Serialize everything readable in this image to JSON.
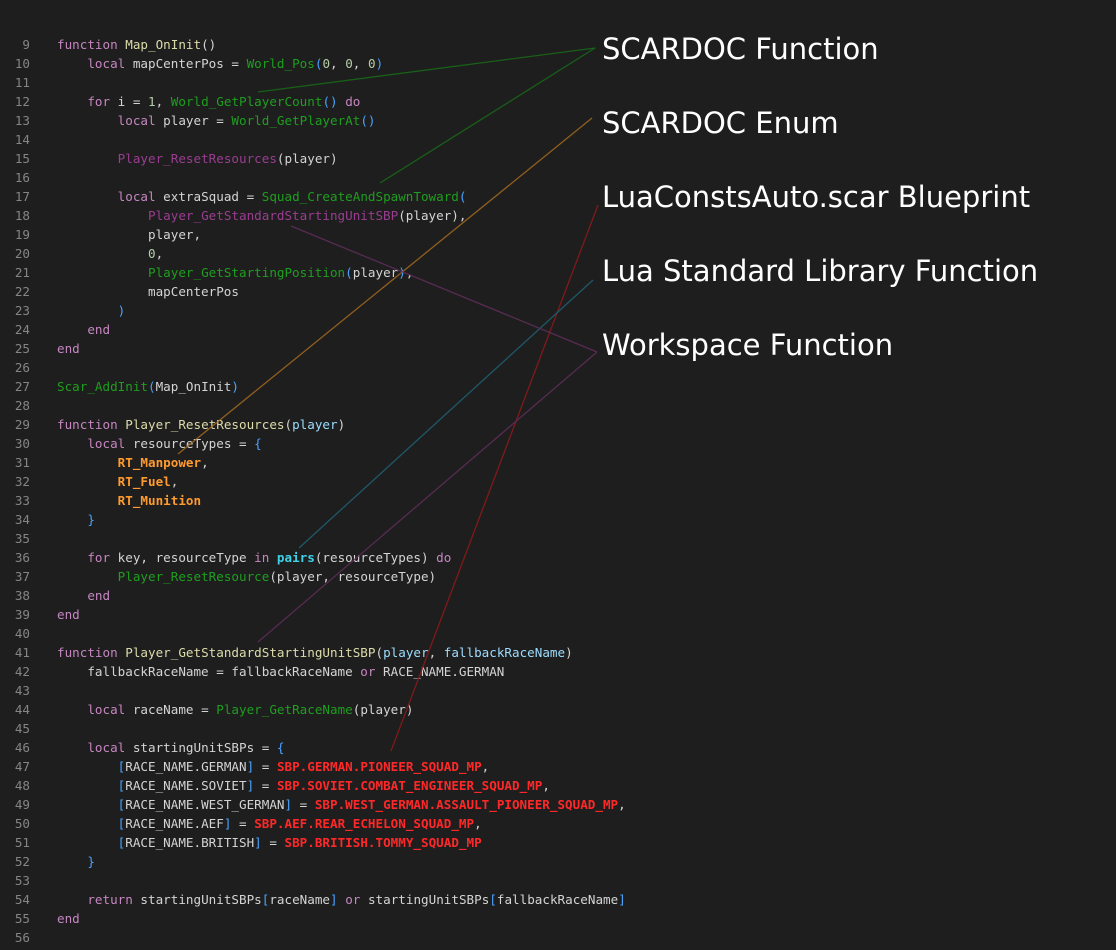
{
  "editor": {
    "lines": [
      {
        "num": "9",
        "tokens": [
          {
            "t": "function",
            "k": "kw"
          },
          {
            "t": " ",
            "k": "plain"
          },
          {
            "t": "Map_OnInit",
            "k": "fn"
          },
          {
            "t": "()",
            "k": "plain"
          }
        ]
      },
      {
        "num": "10",
        "tokens": [
          {
            "t": "    ",
            "k": "plain"
          },
          {
            "t": "local",
            "k": "kw"
          },
          {
            "t": " mapCenterPos = ",
            "k": "plain"
          },
          {
            "t": "World_Pos",
            "k": "scar"
          },
          {
            "t": "(",
            "k": "bracket"
          },
          {
            "t": "0",
            "k": "num"
          },
          {
            "t": ", ",
            "k": "plain"
          },
          {
            "t": "0",
            "k": "num"
          },
          {
            "t": ", ",
            "k": "plain"
          },
          {
            "t": "0",
            "k": "num"
          },
          {
            "t": ")",
            "k": "bracket"
          }
        ]
      },
      {
        "num": "11",
        "tokens": []
      },
      {
        "num": "12",
        "tokens": [
          {
            "t": "    ",
            "k": "plain"
          },
          {
            "t": "for",
            "k": "kw"
          },
          {
            "t": " i = ",
            "k": "plain"
          },
          {
            "t": "1",
            "k": "num"
          },
          {
            "t": ", ",
            "k": "plain"
          },
          {
            "t": "World_GetPlayerCount",
            "k": "scar"
          },
          {
            "t": "()",
            "k": "bracket"
          },
          {
            "t": " ",
            "k": "plain"
          },
          {
            "t": "do",
            "k": "kw"
          }
        ]
      },
      {
        "num": "13",
        "tokens": [
          {
            "t": "        ",
            "k": "plain"
          },
          {
            "t": "local",
            "k": "kw"
          },
          {
            "t": " player = ",
            "k": "plain"
          },
          {
            "t": "World_GetPlayerAt",
            "k": "scar"
          },
          {
            "t": "()",
            "k": "bracket"
          }
        ]
      },
      {
        "num": "14",
        "tokens": []
      },
      {
        "num": "15",
        "tokens": [
          {
            "t": "        ",
            "k": "plain"
          },
          {
            "t": "Player_ResetResources",
            "k": "ws"
          },
          {
            "t": "(player)",
            "k": "plain"
          }
        ]
      },
      {
        "num": "16",
        "tokens": []
      },
      {
        "num": "17",
        "tokens": [
          {
            "t": "        ",
            "k": "plain"
          },
          {
            "t": "local",
            "k": "kw"
          },
          {
            "t": " extraSquad = ",
            "k": "plain"
          },
          {
            "t": "Squad_CreateAndSpawnToward",
            "k": "scar"
          },
          {
            "t": "(",
            "k": "bracket"
          }
        ]
      },
      {
        "num": "18",
        "tokens": [
          {
            "t": "            ",
            "k": "plain"
          },
          {
            "t": "Player_GetStandardStartingUnitSBP",
            "k": "ws"
          },
          {
            "t": "(player),",
            "k": "plain"
          }
        ]
      },
      {
        "num": "19",
        "tokens": [
          {
            "t": "            player,",
            "k": "plain"
          }
        ]
      },
      {
        "num": "20",
        "tokens": [
          {
            "t": "            ",
            "k": "plain"
          },
          {
            "t": "0",
            "k": "num"
          },
          {
            "t": ",",
            "k": "plain"
          }
        ]
      },
      {
        "num": "21",
        "tokens": [
          {
            "t": "            ",
            "k": "plain"
          },
          {
            "t": "Player_GetStartingPosition",
            "k": "scar"
          },
          {
            "t": "(",
            "k": "bracket"
          },
          {
            "t": "player",
            "k": "plain"
          },
          {
            "t": ")",
            "k": "bracket"
          },
          {
            "t": ",",
            "k": "plain"
          }
        ]
      },
      {
        "num": "22",
        "tokens": [
          {
            "t": "            mapCenterPos",
            "k": "plain"
          }
        ]
      },
      {
        "num": "23",
        "tokens": [
          {
            "t": "        ",
            "k": "plain"
          },
          {
            "t": ")",
            "k": "bracket"
          }
        ]
      },
      {
        "num": "24",
        "tokens": [
          {
            "t": "    ",
            "k": "plain"
          },
          {
            "t": "end",
            "k": "kw"
          }
        ]
      },
      {
        "num": "25",
        "tokens": [
          {
            "t": "end",
            "k": "kw"
          }
        ]
      },
      {
        "num": "26",
        "tokens": []
      },
      {
        "num": "27",
        "tokens": [
          {
            "t": "Scar_AddInit",
            "k": "scar"
          },
          {
            "t": "(",
            "k": "bracket"
          },
          {
            "t": "Map_OnInit",
            "k": "plain"
          },
          {
            "t": ")",
            "k": "bracket"
          }
        ]
      },
      {
        "num": "28",
        "tokens": []
      },
      {
        "num": "29",
        "tokens": [
          {
            "t": "function",
            "k": "kw"
          },
          {
            "t": " ",
            "k": "plain"
          },
          {
            "t": "Player_ResetResources",
            "k": "fn"
          },
          {
            "t": "(",
            "k": "plain"
          },
          {
            "t": "player",
            "k": "var"
          },
          {
            "t": ")",
            "k": "plain"
          }
        ]
      },
      {
        "num": "30",
        "tokens": [
          {
            "t": "    ",
            "k": "plain"
          },
          {
            "t": "local",
            "k": "kw"
          },
          {
            "t": " resourceTypes = ",
            "k": "plain"
          },
          {
            "t": "{",
            "k": "bracket"
          }
        ]
      },
      {
        "num": "31",
        "tokens": [
          {
            "t": "        ",
            "k": "plain"
          },
          {
            "t": "RT_Manpower",
            "k": "enum"
          },
          {
            "t": ",",
            "k": "plain"
          }
        ]
      },
      {
        "num": "32",
        "tokens": [
          {
            "t": "        ",
            "k": "plain"
          },
          {
            "t": "RT_Fuel",
            "k": "enum"
          },
          {
            "t": ",",
            "k": "plain"
          }
        ]
      },
      {
        "num": "33",
        "tokens": [
          {
            "t": "        ",
            "k": "plain"
          },
          {
            "t": "RT_Munition",
            "k": "enum"
          }
        ]
      },
      {
        "num": "34",
        "tokens": [
          {
            "t": "    ",
            "k": "plain"
          },
          {
            "t": "}",
            "k": "bracket"
          }
        ]
      },
      {
        "num": "35",
        "tokens": []
      },
      {
        "num": "36",
        "tokens": [
          {
            "t": "    ",
            "k": "plain"
          },
          {
            "t": "for",
            "k": "kw"
          },
          {
            "t": " key, resourceType ",
            "k": "plain"
          },
          {
            "t": "in",
            "k": "kw"
          },
          {
            "t": " ",
            "k": "plain"
          },
          {
            "t": "pairs",
            "k": "lib"
          },
          {
            "t": "(resourceTypes) ",
            "k": "plain"
          },
          {
            "t": "do",
            "k": "kw"
          }
        ]
      },
      {
        "num": "37",
        "tokens": [
          {
            "t": "        ",
            "k": "plain"
          },
          {
            "t": "Player_ResetResource",
            "k": "scar"
          },
          {
            "t": "(player, resourceType)",
            "k": "plain"
          }
        ]
      },
      {
        "num": "38",
        "tokens": [
          {
            "t": "    ",
            "k": "plain"
          },
          {
            "t": "end",
            "k": "kw"
          }
        ]
      },
      {
        "num": "39",
        "tokens": [
          {
            "t": "end",
            "k": "kw"
          }
        ]
      },
      {
        "num": "40",
        "tokens": []
      },
      {
        "num": "41",
        "tokens": [
          {
            "t": "function",
            "k": "kw"
          },
          {
            "t": " ",
            "k": "plain"
          },
          {
            "t": "Player_GetStandardStartingUnitSBP",
            "k": "fn"
          },
          {
            "t": "(",
            "k": "plain"
          },
          {
            "t": "player",
            "k": "var"
          },
          {
            "t": ", ",
            "k": "plain"
          },
          {
            "t": "fallbackRaceName",
            "k": "var"
          },
          {
            "t": ")",
            "k": "plain"
          }
        ]
      },
      {
        "num": "42",
        "tokens": [
          {
            "t": "    fallbackRaceName = fallbackRaceName ",
            "k": "plain"
          },
          {
            "t": "or",
            "k": "kw"
          },
          {
            "t": " RACE_NAME.GERMAN",
            "k": "plain"
          }
        ]
      },
      {
        "num": "43",
        "tokens": []
      },
      {
        "num": "44",
        "tokens": [
          {
            "t": "    ",
            "k": "plain"
          },
          {
            "t": "local",
            "k": "kw"
          },
          {
            "t": " raceName = ",
            "k": "plain"
          },
          {
            "t": "Player_GetRaceName",
            "k": "scar"
          },
          {
            "t": "(player)",
            "k": "plain"
          }
        ]
      },
      {
        "num": "45",
        "tokens": []
      },
      {
        "num": "46",
        "tokens": [
          {
            "t": "    ",
            "k": "plain"
          },
          {
            "t": "local",
            "k": "kw"
          },
          {
            "t": " startingUnitSBPs = ",
            "k": "plain"
          },
          {
            "t": "{",
            "k": "bracket"
          }
        ]
      },
      {
        "num": "47",
        "tokens": [
          {
            "t": "        ",
            "k": "plain"
          },
          {
            "t": "[",
            "k": "bracket"
          },
          {
            "t": "RACE_NAME.GERMAN",
            "k": "plain"
          },
          {
            "t": "]",
            "k": "bracket"
          },
          {
            "t": " = ",
            "k": "plain"
          },
          {
            "t": "SBP.GERMAN.PIONEER_SQUAD_MP",
            "k": "bp"
          },
          {
            "t": ",",
            "k": "plain"
          }
        ]
      },
      {
        "num": "48",
        "tokens": [
          {
            "t": "        ",
            "k": "plain"
          },
          {
            "t": "[",
            "k": "bracket"
          },
          {
            "t": "RACE_NAME.SOVIET",
            "k": "plain"
          },
          {
            "t": "]",
            "k": "bracket"
          },
          {
            "t": " = ",
            "k": "plain"
          },
          {
            "t": "SBP.SOVIET.COMBAT_ENGINEER_SQUAD_MP",
            "k": "bp"
          },
          {
            "t": ",",
            "k": "plain"
          }
        ]
      },
      {
        "num": "49",
        "tokens": [
          {
            "t": "        ",
            "k": "plain"
          },
          {
            "t": "[",
            "k": "bracket"
          },
          {
            "t": "RACE_NAME.WEST_GERMAN",
            "k": "plain"
          },
          {
            "t": "]",
            "k": "bracket"
          },
          {
            "t": " = ",
            "k": "plain"
          },
          {
            "t": "SBP.WEST_GERMAN.ASSAULT_PIONEER_SQUAD_MP",
            "k": "bp"
          },
          {
            "t": ",",
            "k": "plain"
          }
        ]
      },
      {
        "num": "50",
        "tokens": [
          {
            "t": "        ",
            "k": "plain"
          },
          {
            "t": "[",
            "k": "bracket"
          },
          {
            "t": "RACE_NAME.AEF",
            "k": "plain"
          },
          {
            "t": "]",
            "k": "bracket"
          },
          {
            "t": " = ",
            "k": "plain"
          },
          {
            "t": "SBP.AEF.REAR_ECHELON_SQUAD_MP",
            "k": "bp"
          },
          {
            "t": ",",
            "k": "plain"
          }
        ]
      },
      {
        "num": "51",
        "tokens": [
          {
            "t": "        ",
            "k": "plain"
          },
          {
            "t": "[",
            "k": "bracket"
          },
          {
            "t": "RACE_NAME.BRITISH",
            "k": "plain"
          },
          {
            "t": "]",
            "k": "bracket"
          },
          {
            "t": " = ",
            "k": "plain"
          },
          {
            "t": "SBP.BRITISH.TOMMY_SQUAD_MP",
            "k": "bp"
          }
        ]
      },
      {
        "num": "52",
        "tokens": [
          {
            "t": "    ",
            "k": "plain"
          },
          {
            "t": "}",
            "k": "bracket"
          }
        ]
      },
      {
        "num": "53",
        "tokens": []
      },
      {
        "num": "54",
        "tokens": [
          {
            "t": "    ",
            "k": "plain"
          },
          {
            "t": "return",
            "k": "kw"
          },
          {
            "t": " startingUnitSBPs",
            "k": "plain"
          },
          {
            "t": "[",
            "k": "bracket"
          },
          {
            "t": "raceName",
            "k": "plain"
          },
          {
            "t": "]",
            "k": "bracket"
          },
          {
            "t": " ",
            "k": "plain"
          },
          {
            "t": "or",
            "k": "kw"
          },
          {
            "t": " startingUnitSBPs",
            "k": "plain"
          },
          {
            "t": "[",
            "k": "bracket"
          },
          {
            "t": "fallbackRaceName",
            "k": "plain"
          },
          {
            "t": "]",
            "k": "bracket"
          }
        ]
      },
      {
        "num": "55",
        "tokens": [
          {
            "t": "end",
            "k": "kw"
          }
        ]
      },
      {
        "num": "56",
        "tokens": []
      }
    ]
  },
  "legend": {
    "scardoc_function": "SCARDOC Function",
    "scardoc_enum": "SCARDOC Enum",
    "blueprint": "LuaConstsAuto.scar Blueprint",
    "stdlib_function": "Lua Standard Library Function",
    "workspace_function": "Workspace Function"
  },
  "colors": {
    "background": "#1e1e1e",
    "scardoc_function": "#1e9e1e",
    "scardoc_enum": "#ff9a2e",
    "blueprint": "#ff2828",
    "stdlib_function": "#3ed1e8",
    "workspace_function": "#9a3d90"
  }
}
